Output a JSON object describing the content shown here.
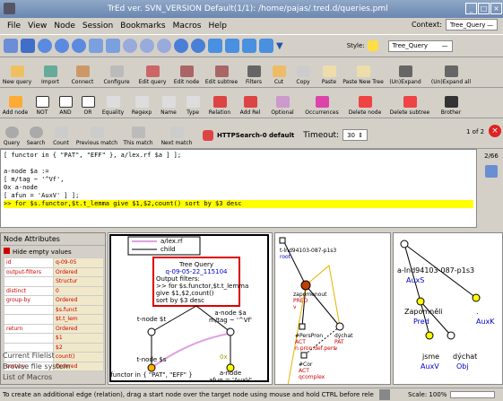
{
  "title": "TrEd ver. SVN_VERSION    Default(1/1): /home/pajas/.tred.d/queries.pml",
  "menu": [
    "File",
    "View",
    "Node",
    "Session",
    "Bookmarks",
    "Macros",
    "Help"
  ],
  "context": {
    "label": "Context:",
    "value": "Tree_Query",
    "style_label": "Style:",
    "style_value": "Tree_Query"
  },
  "row2": [
    "New query",
    "Import",
    "Connect",
    "Configure",
    "Edit query",
    "Edit node",
    "Edit subtree",
    "Filters",
    "Cut",
    "Copy",
    "Paste",
    "Paste New Tree",
    "(Un)Expand",
    "(Un)Expand all"
  ],
  "row3": [
    "Add node",
    "NOT",
    "AND",
    "OR",
    "Equality",
    "Regexp",
    "Name",
    "Type",
    "Relation",
    "Add Rel",
    "Optional",
    "Occurrences",
    "Delete node",
    "Delete subtree",
    "Brother"
  ],
  "row4": [
    "Query",
    "Search",
    "Count",
    "Previous match",
    "This match",
    "Next match"
  ],
  "search": {
    "method": "HTTPSearch-0 default",
    "timeout_label": "Timeout:",
    "timeout": "30",
    "page": "1 of 2"
  },
  "editor": {
    "lines": [
      "[ functor in { \"PAT\", \"EFF\" }, a/lex.rf $a ] ];",
      "",
      "a-node $a :=",
      "[ m/tag ~ '^Vf',",
      "  0x  a-node",
      "  [ afun = 'AuxV' ] ];"
    ],
    "highlight": ">> for $s.functor,$t.t_lemma give $1,$2,count() sort by $3 desc",
    "counter": "2/66"
  },
  "attrs": {
    "title": "Node Attributes",
    "hide_label": "Hide empty values",
    "rows": [
      [
        "id",
        "q-09-05"
      ],
      [
        "output-filters",
        "Ordered"
      ],
      [
        "",
        "Structur"
      ],
      [
        "distinct",
        "0"
      ],
      [
        "group-by",
        "Ordered"
      ],
      [
        "",
        "$s.funct"
      ],
      [
        "",
        "$t.t_lem"
      ],
      [
        "return",
        "Ordered"
      ],
      [
        "",
        "$1"
      ],
      [
        "",
        "$2"
      ],
      [
        "",
        "count()"
      ],
      [
        "sort-by",
        "Ordered"
      ]
    ],
    "links": [
      "Current Filelist",
      "Browse file system",
      "List of Macros"
    ]
  },
  "legend": {
    "a": "a/lex.rf",
    "b": "child"
  },
  "query": {
    "title": "Tree Query",
    "id": "q-09-05-22_115104",
    "filters_label": "Output filters:",
    "filters": [
      ">> for $s.functor,$t.t_lemma",
      "   give $1,$2,count()",
      "   sort by $3 desc"
    ]
  },
  "nodes": {
    "t": "t-node $t",
    "a_title": "a-node $a",
    "a_tag": "m/tag ~ '^Vf'",
    "ox": "0x",
    "a2_title": "a-node",
    "a2_afun": "afun = 'AuxV'",
    "s_title": "t-node $s",
    "s_cond": "functor in { \"PAT\", \"EFF\" }"
  },
  "tree3": {
    "root_id": "t-lnd94103-087-p1s3",
    "root": "root",
    "n1": "zapomenout",
    "n1b": "PRED",
    "n1c": "v",
    "n2": "#PersPron",
    "n2b": "ACT",
    "n2c": "n.pron.def.pers",
    "n3": "dýchat",
    "n3b": "PAT",
    "n3c": "v",
    "n4": "#Cor",
    "n4b": "ACT",
    "n4c": "qcomplex"
  },
  "tree4": {
    "root": "a-lnd94103-087-p1s3",
    "rootb": "AuxS",
    "n1": "Zapomněli",
    "n1b": "Pred",
    "n2": ".",
    "n2b": "AuxK",
    "n3": "jsme",
    "n3b": "AuxV",
    "n4": "dýchat",
    "n4b": "Obj"
  },
  "status": {
    "text": "To create an additional edge (relation), drag a start node over the target node using mouse and hold CTRL before rele",
    "scale": "Scale: 100%"
  }
}
